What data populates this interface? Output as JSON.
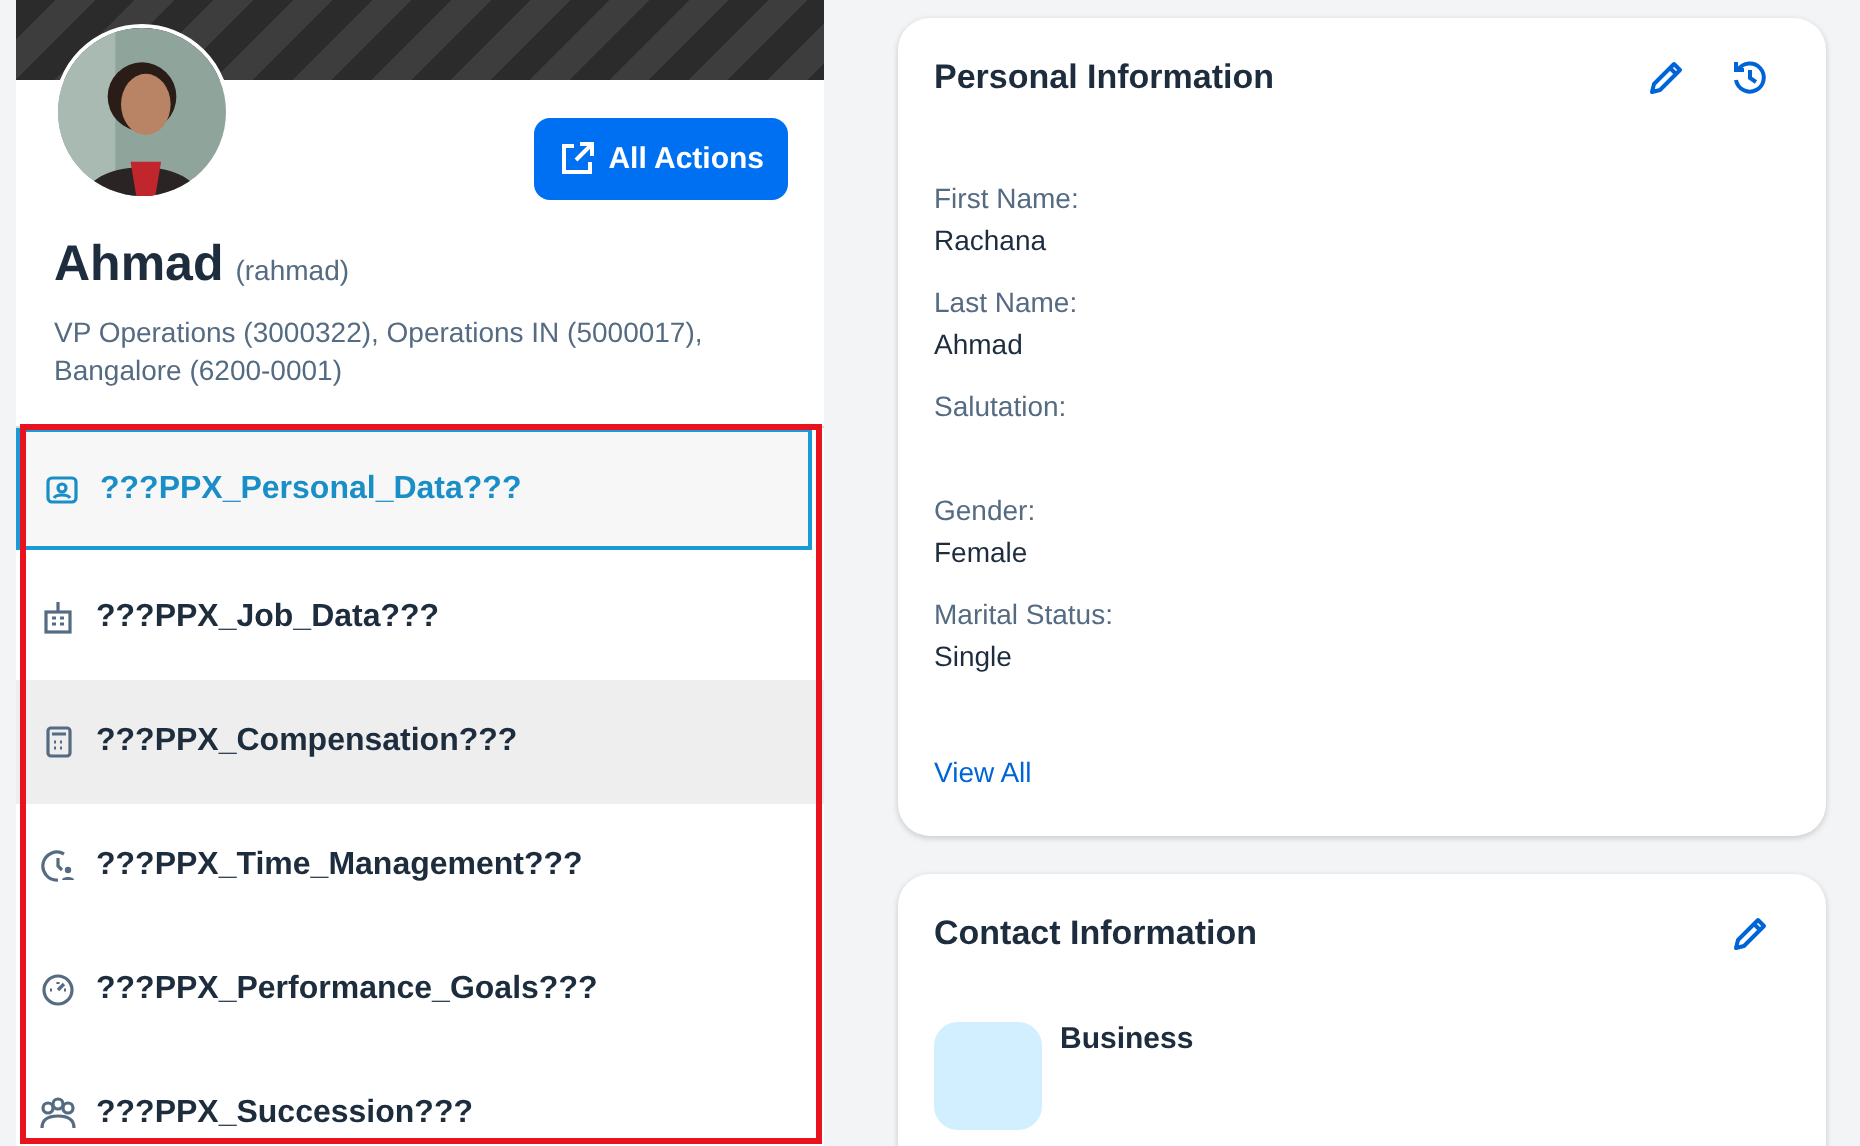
{
  "profile": {
    "name": "Ahmad",
    "username": "(rahmad)",
    "details": "VP Operations (3000322), Operations IN (5000017), Bangalore (6200-0001)",
    "action_button": "All Actions"
  },
  "nav_items": [
    {
      "label": "???PPX_Personal_Data???",
      "selected": true,
      "hovered": false
    },
    {
      "label": "???PPX_Job_Data???",
      "selected": false,
      "hovered": false
    },
    {
      "label": "???PPX_Compensation???",
      "selected": false,
      "hovered": true
    },
    {
      "label": "???PPX_Time_Management???",
      "selected": false,
      "hovered": false
    },
    {
      "label": "???PPX_Performance_Goals???",
      "selected": false,
      "hovered": false
    },
    {
      "label": "???PPX_Succession???",
      "selected": false,
      "hovered": false
    }
  ],
  "personal_information": {
    "title": "Personal Information",
    "fields": [
      {
        "label": "First Name:",
        "value": "Rachana"
      },
      {
        "label": "Last Name:",
        "value": "Ahmad"
      },
      {
        "label": "Salutation:"
      },
      {
        "label": "Gender:",
        "value": "Female"
      },
      {
        "label": "Marital Status:",
        "value": "Single"
      }
    ],
    "link": "View All"
  },
  "contact_information": {
    "title": "Contact Information",
    "entries": [
      {
        "label": "Business"
      }
    ]
  }
}
